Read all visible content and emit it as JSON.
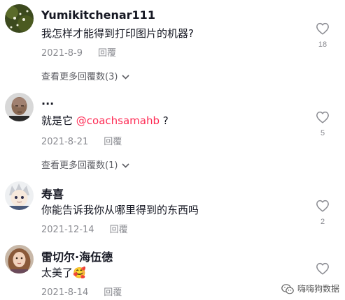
{
  "comments": [
    {
      "username": "Yumikitchenar111",
      "text": "我怎样才能得到打印图片的机器?",
      "date": "2021-8-9",
      "reply_label": "回覆",
      "likes": "18",
      "more_replies": "查看更多回覆数(3)"
    },
    {
      "username": "...",
      "text_before": "就是它 ",
      "mention": "@coachsamahb",
      "text_after": " ?",
      "date": "2021-8-21",
      "reply_label": "回覆",
      "likes": "5",
      "more_replies": "查看更多回覆数(1)"
    },
    {
      "username": "寿喜",
      "text": "你能告诉我你从哪里得到的东西吗",
      "date": "2021-12-14",
      "reply_label": "回覆",
      "likes": "2"
    },
    {
      "username": "雷切尔·海伍德",
      "text": "太美了",
      "emoji": "🥰",
      "date": "2021-8-14",
      "reply_label": "回覆"
    }
  ],
  "watermark": {
    "text": "嗨嗨狗数据",
    "icon": "wechat-icon"
  },
  "colors": {
    "mention": "#fe2c55",
    "meta": "#8a8b91",
    "text": "#161823"
  },
  "icons": {
    "like": "heart-outline-icon",
    "expand": "chevron-down-icon"
  }
}
